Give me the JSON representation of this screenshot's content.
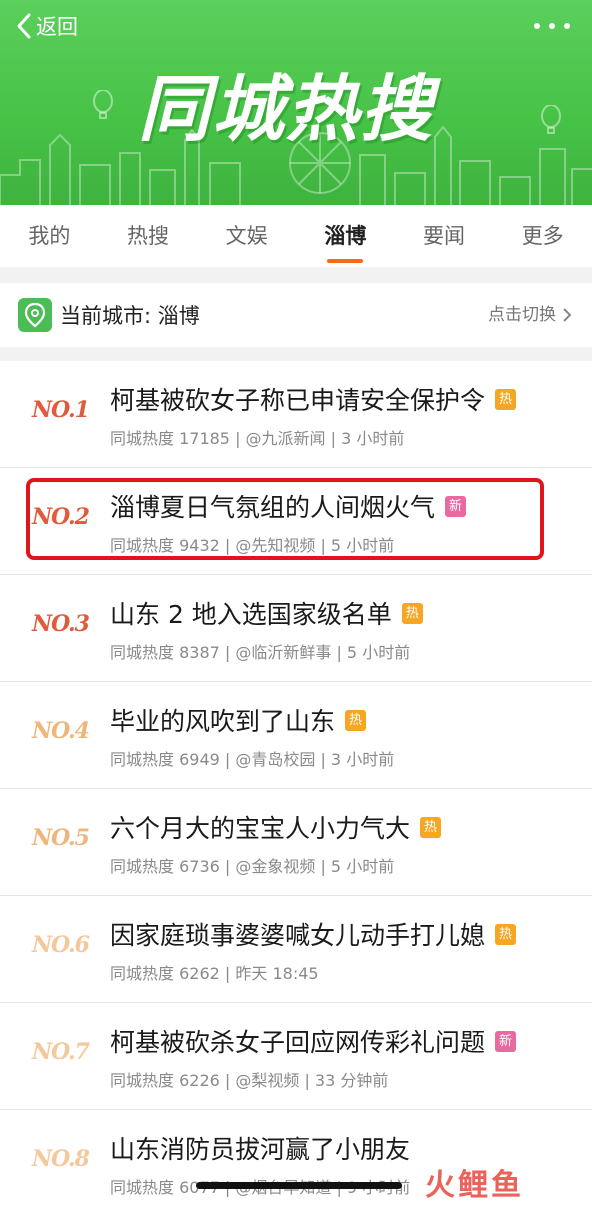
{
  "header": {
    "back_label": "返回",
    "banner_title": "同城热搜"
  },
  "tabs": [
    {
      "label": "我的",
      "active": false
    },
    {
      "label": "热搜",
      "active": false
    },
    {
      "label": "文娱",
      "active": false
    },
    {
      "label": "淄博",
      "active": true
    },
    {
      "label": "要闻",
      "active": false
    },
    {
      "label": "更多",
      "active": false
    }
  ],
  "city": {
    "label": "当前城市: 淄博",
    "switch_label": "点击切换"
  },
  "items": [
    {
      "rank": "NO.1",
      "title": "柯基被砍女子称已申请安全保护令",
      "badge": "热",
      "badge_type": "hot",
      "meta": "同城热度 17185 | @九派新闻 | 3 小时前"
    },
    {
      "rank": "NO.2",
      "title": "淄博夏日气氛组的人间烟火气",
      "badge": "新",
      "badge_type": "new",
      "meta": "同城热度 9432 | @先知视频 | 5 小时前"
    },
    {
      "rank": "NO.3",
      "title": "山东 2 地入选国家级名单",
      "badge": "热",
      "badge_type": "hot",
      "meta": "同城热度 8387 | @临沂新鲜事 | 5 小时前"
    },
    {
      "rank": "NO.4",
      "title": "毕业的风吹到了山东",
      "badge": "热",
      "badge_type": "hot",
      "meta": "同城热度 6949 | @青岛校园 | 3 小时前"
    },
    {
      "rank": "NO.5",
      "title": "六个月大的宝宝人小力气大",
      "badge": "热",
      "badge_type": "hot",
      "meta": "同城热度 6736 | @金象视频 | 5 小时前"
    },
    {
      "rank": "NO.6",
      "title": "因家庭琐事婆婆喊女儿动手打儿媳",
      "badge": "热",
      "badge_type": "hot",
      "meta": "同城热度 6262 | 昨天 18:45"
    },
    {
      "rank": "NO.7",
      "title": "柯基被砍杀女子回应网传彩礼问题",
      "badge": "新",
      "badge_type": "new",
      "meta": "同城热度 6226 | @梨视频 | 33 分钟前"
    },
    {
      "rank": "NO.8",
      "title": "山东消防员拔河赢了小朋友",
      "badge": "",
      "badge_type": "none",
      "meta": "同城热度 6077 | @烟台早知道 | 9 小时前"
    }
  ],
  "watermark": "火鲤鱼",
  "colors": {
    "banner_green": "#46c246",
    "tab_indicator": "#f26b21",
    "highlight_red": "#e0141b",
    "hot_badge": "#f5a623",
    "new_badge": "#e96aa0"
  }
}
